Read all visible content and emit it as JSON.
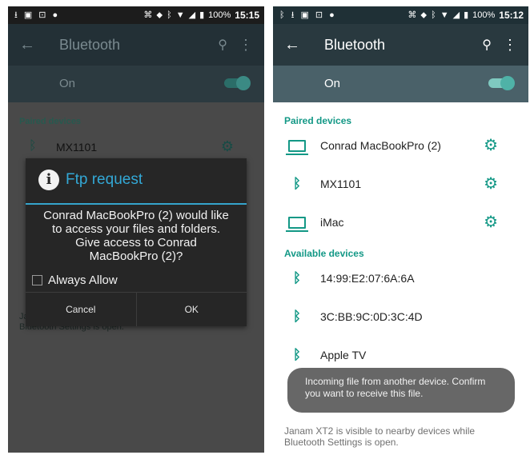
{
  "left_screen": {
    "status_bar": {
      "battery": "100%",
      "time": "15:15"
    },
    "title": "Bluetooth",
    "toggle_label": "On",
    "section_paired": "Paired devices",
    "paired_device": "MX1101",
    "footer_partial": "Ja",
    "footer_partial2": "Bluetooth Settings is open.",
    "dialog": {
      "title": "Ftp request",
      "message": "Conrad MacBookPro (2) would like to access your files and folders. Give access to Conrad MacBookPro (2)?",
      "checkbox_label": "Always Allow",
      "cancel": "Cancel",
      "ok": "OK"
    }
  },
  "right_screen": {
    "status_bar": {
      "battery": "100%",
      "time": "15:12"
    },
    "title": "Bluetooth",
    "toggle_label": "On",
    "section_paired": "Paired devices",
    "paired_devices": [
      {
        "name": "Conrad MacBookPro (2)",
        "icon": "laptop-icon"
      },
      {
        "name": "MX1101",
        "icon": "bluetooth-icon"
      },
      {
        "name": "iMac",
        "icon": "laptop-icon"
      }
    ],
    "section_available": "Available devices",
    "available_devices": [
      {
        "name": "14:99:E2:07:6A:6A"
      },
      {
        "name": "3C:BB:9C:0D:3C:4D"
      },
      {
        "name": "Apple TV"
      }
    ],
    "toast": "Incoming file from another device. Confirm you want to receive this file.",
    "footer": "Janam XT2 is visible to nearby devices while Bluetooth Settings is open."
  }
}
